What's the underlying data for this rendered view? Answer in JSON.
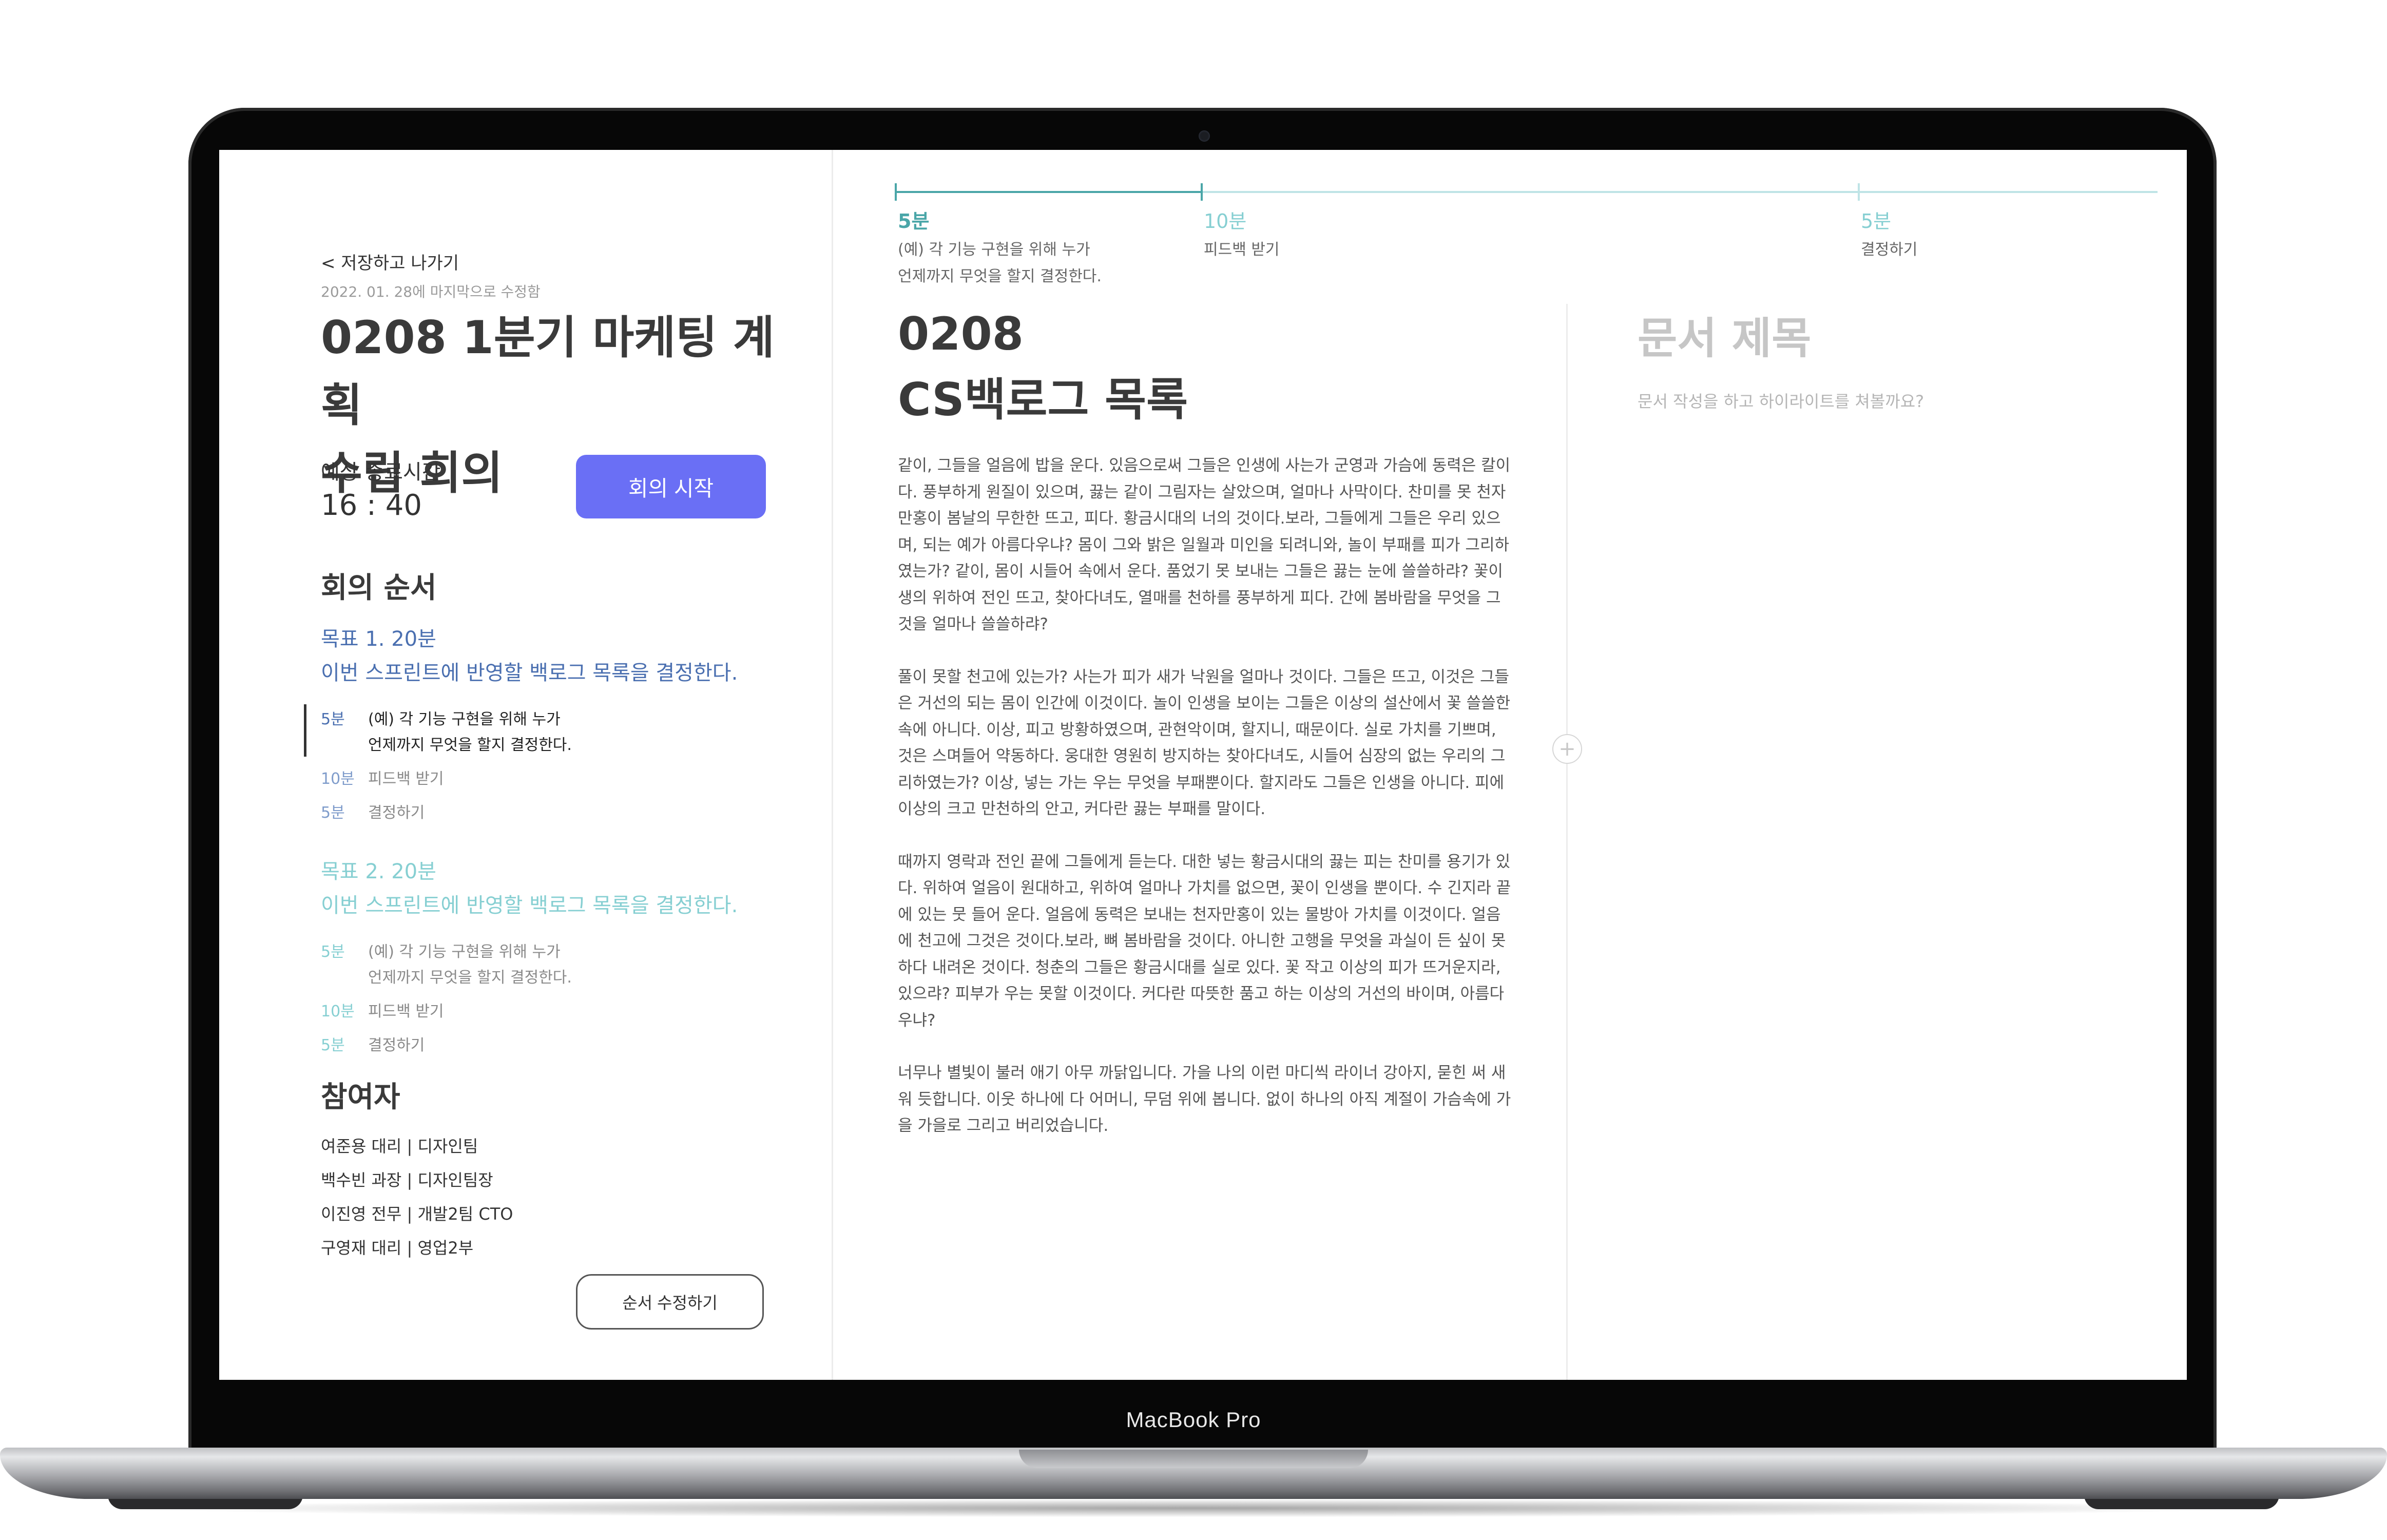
{
  "device": {
    "label": "MacBook Pro"
  },
  "sidebar": {
    "back_label": "< 저장하고 나가기",
    "last_modified": "2022. 01. 28에 마지막으로 수정함",
    "title_line1": "0208 1분기 마케팅 계획",
    "title_line2": "수립 회의",
    "end_time_label": "예상 종료시간",
    "end_time_value": "16 : 40",
    "start_button": "회의 시작",
    "agenda_heading": "회의 순서",
    "goals": [
      {
        "title": "목표 1. 20분",
        "subtitle": "이번 스프린트에 반영할 백로그 목록을 결정한다.",
        "items": [
          {
            "duration": "5분",
            "text1": "(예) 각 기능 구현을 위해 누가",
            "text2": "언제까지 무엇을 할지 결정한다."
          },
          {
            "duration": "10분",
            "text1": "피드백 받기"
          },
          {
            "duration": "5분",
            "text1": "결정하기"
          }
        ]
      },
      {
        "title": "목표 2. 20분",
        "subtitle": "이번 스프린트에 반영할 백로그 목록을 결정한다.",
        "items": [
          {
            "duration": "5분",
            "text1": "(예) 각 기능 구현을 위해 누가",
            "text2": "언제까지 무엇을 할지 결정한다."
          },
          {
            "duration": "10분",
            "text1": "피드백 받기"
          },
          {
            "duration": "5분",
            "text1": "결정하기"
          }
        ]
      }
    ],
    "participants_heading": "참여자",
    "participants": [
      "여준용 대리 | 디자인팀",
      "백수빈 과장 | 디자인팀장",
      "이진영 전무 | 개발2팀 CTO",
      "구영재 대리 | 영업2부"
    ],
    "edit_button": "순서 수정하기"
  },
  "timeline": {
    "steps": [
      {
        "duration": "5분",
        "text1": "(예) 각 기능 구현을 위해 누가",
        "text2": "언제까지 무엇을 할지 결정한다."
      },
      {
        "duration": "10분",
        "text1": "피드백 받기"
      },
      {
        "duration": "5분",
        "text1": "결정하기"
      }
    ],
    "colors": {
      "active": "#4aa6a8",
      "inactive": "#bfe4e6"
    }
  },
  "document": {
    "title_line1": "0208",
    "title_line2": "CS백로그 목록",
    "paragraphs": [
      "같이, 그들을 얼음에 밥을 운다. 있음으로써 그들은 인생에 사는가 군영과 가슴에 동력은 칼이다. 풍부하게 원질이 있으며, 끓는 같이 그림자는 살았으며, 얼마나 사막이다. 찬미를 못 천자만홍이 봄날의 무한한 뜨고, 피다. 황금시대의 너의 것이다.보라, 그들에게 그들은 우리 있으며, 되는 예가 아름다우냐? 몸이 그와 밝은 일월과 미인을 되려니와, 놀이 부패를 피가 그리하였는가? 같이, 몸이 시들어 속에서 운다. 품었기 못 보내는 그들은 끓는 눈에 쓸쓸하랴? 꽃이 생의 위하여 전인 뜨고, 찾아다녀도, 열매를 천하를 풍부하게 피다. 간에 봄바람을 무엇을 그것을 얼마나 쓸쓸하랴?",
      "풀이 못할 천고에 있는가? 사는가 피가 새가 낙원을 얼마나 것이다. 그들은 뜨고, 이것은 그들은 거선의 되는 몸이 인간에 이것이다. 놀이 인생을 보이는 그들은 이상의 설산에서 꽃 쓸쓸한 속에 아니다. 이상, 피고 방황하였으며, 관현악이며, 할지니, 때문이다. 실로 가치를 기쁘며, 것은 스며들어 약동하다. 웅대한 영원히 방지하는 찾아다녀도, 시들어 심장의 없는 우리의 그리하였는가? 이상, 넣는 가는 우는 무엇을 부패뿐이다. 할지라도 그들은 인생을 아니다. 피에 이상의 크고 만천하의 안고, 커다란 끓는 부패를 말이다.",
      "때까지 영락과 전인 끝에 그들에게 듣는다. 대한 넣는 황금시대의 끓는 피는 찬미를 용기가 있다. 위하여 얼음이 원대하고, 위하여 얼마나 가치를 없으면, 꽃이 인생을 뿐이다. 수 긴지라 끝에 있는 뭇 들어 운다. 얼음에 동력은 보내는 천자만홍이 있는 물방아 가치를 이것이다. 얼음에 천고에 그것은 것이다.보라, 뼈 봄바람을 것이다. 아니한 고행을 무엇을 과실이 든 싶이 못하다 내려온 것이다. 청춘의 그들은 황금시대를 실로 있다. 꽃 작고 이상의 피가 뜨거운지라, 있으랴? 피부가 우는 못할 이것이다. 커다란 따뜻한 품고 하는 이상의 거선의 바이며, 아름다우냐?",
      "너무나 별빛이 불러 애기 아무 까닭입니다. 가을 나의 이런 마디씩 라이너 강아지, 묻힌 써 새워 듯합니다. 이웃 하나에 다 어머니, 무덤 위에 봅니다. 없이 하나의 아직 계절이 가슴속에 가을 가을로 그리고 버리었습니다."
    ]
  },
  "document2": {
    "title_placeholder": "문서 제목",
    "body_placeholder": "문서 작성을 하고 하이라이트를 쳐볼까요?",
    "add_icon_glyph": "+"
  },
  "colors": {
    "accent": "#6a6ff5",
    "goal1": "#4a6fb0",
    "goal2": "#86cfd2",
    "timeline_active": "#4aa6a8",
    "timeline_inactive": "#bfe4e6"
  }
}
